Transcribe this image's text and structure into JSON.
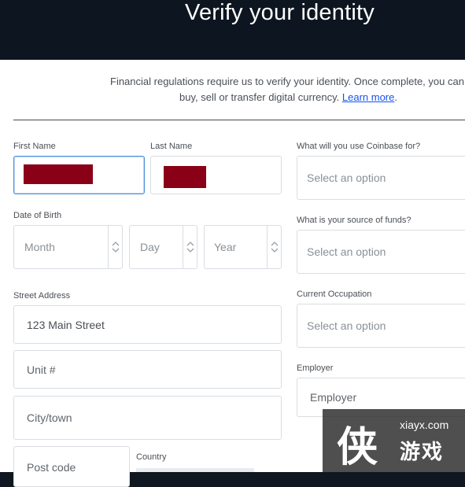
{
  "header": {
    "title": "Verify your identity"
  },
  "intro": {
    "line1": "Financial regulations require us to verify your identity. Once complete, you can",
    "line2": "buy, sell or transfer digital currency.",
    "link": "Learn more",
    "suffix": "."
  },
  "form": {
    "first_name": {
      "label": "First Name"
    },
    "last_name": {
      "label": "Last Name"
    },
    "dob": {
      "label": "Date of Birth",
      "month_placeholder": "Month",
      "day_placeholder": "Day",
      "year_placeholder": "Year"
    },
    "street": {
      "label": "Street Address",
      "value": "123 Main Street"
    },
    "unit": {
      "placeholder": "Unit #"
    },
    "city": {
      "placeholder": "City/town"
    },
    "postcode": {
      "placeholder": "Post code"
    },
    "country": {
      "label": "Country"
    },
    "use_coinbase": {
      "label": "What will you use Coinbase for?",
      "placeholder": "Select an option"
    },
    "source_funds": {
      "label": "What is your source of funds?",
      "placeholder": "Select an option"
    },
    "occupation": {
      "label": "Current Occupation",
      "placeholder": "Select an option"
    },
    "employer": {
      "label": "Employer",
      "placeholder": "Employer"
    }
  },
  "watermark": {
    "site": "xiayx.com",
    "name": "游戏"
  },
  "colors": {
    "redaction": "#8a0016",
    "link": "#1652f0",
    "focus": "#4d90d8",
    "header_bg": "#0d1620"
  }
}
